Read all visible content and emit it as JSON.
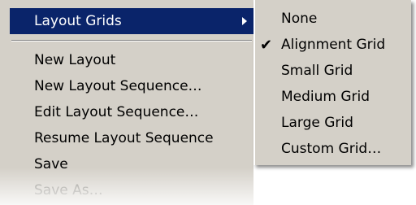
{
  "menu": {
    "items": [
      {
        "label": "Layout Grids",
        "state": "highlighted",
        "has_submenu": true
      },
      {
        "label": "New Layout"
      },
      {
        "label": "New Layout Sequence…"
      },
      {
        "label": "Edit Layout Sequence…"
      },
      {
        "label": "Resume Layout Sequence"
      },
      {
        "label": "Save"
      },
      {
        "label": "Save As…",
        "state": "disabled"
      }
    ]
  },
  "submenu": {
    "items": [
      {
        "label": "None"
      },
      {
        "label": "Alignment Grid",
        "checked": true
      },
      {
        "label": "Small Grid"
      },
      {
        "label": "Medium Grid"
      },
      {
        "label": "Large Grid"
      },
      {
        "label": "Custom Grid…"
      }
    ],
    "check_icon": "checkmark-icon"
  },
  "colors": {
    "menu_bg": "#d4d0c8",
    "highlight_bg": "#0a246a",
    "disabled_text": "#8e8c86"
  }
}
